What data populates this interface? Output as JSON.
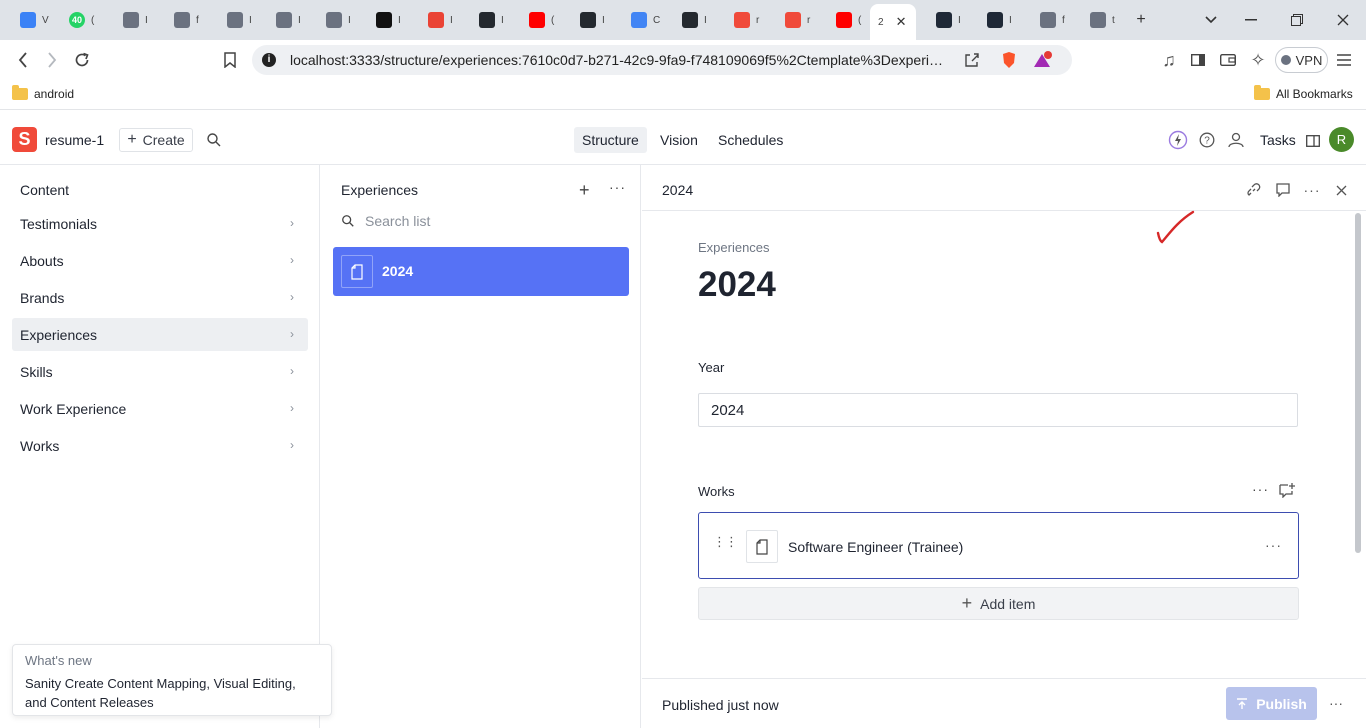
{
  "browser": {
    "tabs": [
      {
        "icon": "react-icon",
        "label": "V",
        "color": "#3b82f6"
      },
      {
        "icon": "whatsapp-icon",
        "label": "(",
        "color": "#25d366",
        "badge": "40"
      },
      {
        "icon": "next-icon",
        "label": "I",
        "color": "#6b7280"
      },
      {
        "icon": "globe-icon",
        "label": "f",
        "color": "#6b7280"
      },
      {
        "icon": "next-icon",
        "label": "I",
        "color": "#6b7280"
      },
      {
        "icon": "next-icon",
        "label": "I",
        "color": "#6b7280"
      },
      {
        "icon": "next-icon",
        "label": "I",
        "color": "#6b7280"
      },
      {
        "icon": "hackerrank-icon",
        "label": "I",
        "color": "#111111"
      },
      {
        "icon": "gmail-icon",
        "label": "I",
        "color": "#ea4335"
      },
      {
        "icon": "github-icon",
        "label": "I",
        "color": "#24292f"
      },
      {
        "icon": "youtube-icon",
        "label": "(",
        "color": "#ff0000"
      },
      {
        "icon": "github-icon",
        "label": "I",
        "color": "#24292f"
      },
      {
        "icon": "google-icon",
        "label": "C",
        "color": "#4285f4"
      },
      {
        "icon": "github-icon",
        "label": "I",
        "color": "#24292f"
      },
      {
        "icon": "sanity-icon",
        "label": "r",
        "color": "#f04a3a"
      },
      {
        "icon": "sanity-icon",
        "label": "r",
        "color": "#f04a3a"
      },
      {
        "icon": "youtube-icon",
        "label": "(",
        "color": "#ff0000"
      },
      {
        "icon": "active-tab",
        "label": "2",
        "color": "#ffffff"
      },
      {
        "icon": "react-icon",
        "label": "I",
        "color": "#1f2937"
      },
      {
        "icon": "react-icon",
        "label": "I",
        "color": "#1f2937"
      },
      {
        "icon": "globe-icon",
        "label": "f",
        "color": "#6b7280"
      },
      {
        "icon": "globe-icon",
        "label": "t",
        "color": "#6b7280"
      }
    ],
    "url": "localhost:3333/structure/experiences:7610c0d7-b271-42c9-9fa9-f748109069f5%2Ctemplate%3Dexperien...",
    "vpn_label": "VPN",
    "brave_badge": "1",
    "bookmarks": {
      "left": "android",
      "right": "All Bookmarks"
    }
  },
  "studio": {
    "workspace": "resume-1",
    "create_label": "Create",
    "avatar_letter": "R",
    "tabs": [
      {
        "label": "Structure",
        "active": true
      },
      {
        "label": "Vision",
        "active": false
      },
      {
        "label": "Schedules",
        "active": false
      }
    ],
    "tasks_label": "Tasks"
  },
  "pane1": {
    "title": "Content",
    "items": [
      "Testimonials",
      "Abouts",
      "Brands",
      "Experiences",
      "Skills",
      "Work Experience",
      "Works"
    ],
    "selected": "Experiences"
  },
  "whats_new": {
    "label": "What's new",
    "text": "Sanity Create Content Mapping, Visual Editing, and Content Releases"
  },
  "pane2": {
    "title": "Experiences",
    "search_placeholder": "Search list",
    "items": [
      "2024"
    ]
  },
  "pane3": {
    "header_title": "2024",
    "breadcrumb": "Experiences",
    "doc_title": "2024",
    "year_label": "Year",
    "year_value": "2024",
    "works_label": "Works",
    "works_items": [
      "Software Engineer (Trainee)"
    ],
    "add_item_label": "Add item",
    "status": "Published just now",
    "publish_label": "Publish"
  },
  "colors": {
    "accent": "#5672f5",
    "brand": "#f04a3a",
    "publish_disabled": "#b8c3ec",
    "annotation": "#d62828"
  }
}
